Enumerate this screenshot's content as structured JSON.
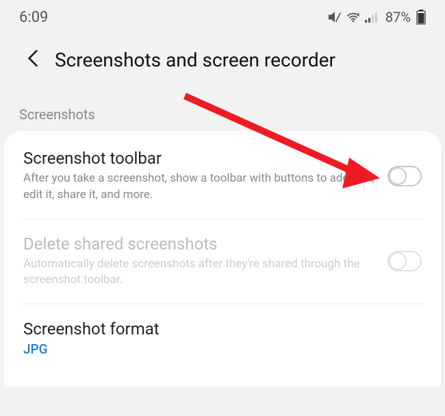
{
  "statusBar": {
    "time": "6:09",
    "batteryPercent": "87%"
  },
  "header": {
    "title": "Screenshots and screen recorder"
  },
  "section": {
    "label": "Screenshots"
  },
  "rows": {
    "toolbar": {
      "title": "Screenshot toolbar",
      "desc": "After you take a screenshot, show a toolbar with buttons to add to it, edit it, share it, and more."
    },
    "deleteShared": {
      "title": "Delete shared screenshots",
      "desc": "Automatically delete screenshots after they're shared through the screenshot toolbar."
    },
    "format": {
      "title": "Screenshot format",
      "value": "JPG"
    }
  }
}
